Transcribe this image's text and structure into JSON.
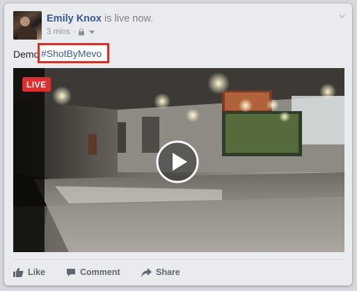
{
  "post": {
    "author": "Emily Knox",
    "status_text": " is live now.",
    "timestamp": "3 mins",
    "separator": " · ",
    "text_prefix": "Demo",
    "hashtag": "#ShotByMevo"
  },
  "video": {
    "live_label": "LIVE"
  },
  "actions": {
    "like": "Like",
    "comment": "Comment",
    "share": "Share"
  },
  "icons": {
    "audience": "lock-icon",
    "privacy_menu": "caret-down-icon",
    "post_menu": "chevron-down-icon",
    "play": "play-icon",
    "like": "thumbs-up-icon",
    "comment": "comment-icon",
    "share": "share-arrow-icon"
  },
  "colors": {
    "link_blue": "#365899",
    "live_red": "#e02d2d",
    "highlight_box": "#e32a1f"
  }
}
